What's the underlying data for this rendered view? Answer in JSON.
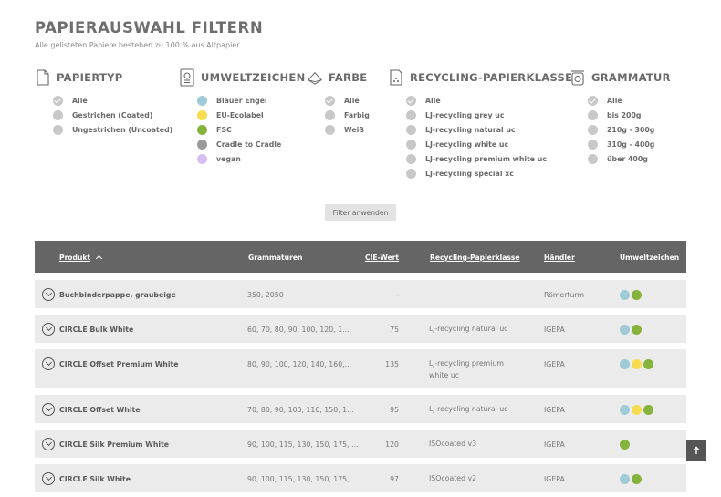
{
  "header": {
    "title": "PAPIERAUSWAHL FILTERN",
    "subtitle": "Alle gelisteten Papiere bestehen zu 100 % aus Altpapier"
  },
  "colors": {
    "blue": "#9ecbd6",
    "yellow": "#f6dc4e",
    "green": "#86b33b",
    "grey": "#9a9a9a",
    "purple": "#d7bdf0",
    "unchecked": "#c8c8c8",
    "header_bg": "#656565",
    "row_bg": "#ebebeb"
  },
  "filters": {
    "papiertyp": {
      "label": "PAPIERTYP",
      "icon": "document-icon",
      "options": [
        "Alle",
        "Gestrichen (Coated)",
        "Ungestrichen (Uncoated)"
      ]
    },
    "umweltzeichen": {
      "label": "UMWELTZEICHEN",
      "icon": "eco-label-icon",
      "options": [
        "Blauer Engel",
        "EU-Ecolabel",
        "FSC",
        "Cradle to Cradle",
        "vegan"
      ]
    },
    "farbe": {
      "label": "FARBE",
      "icon": "paper-stack-icon",
      "options": [
        "Alle",
        "Farbig",
        "Weiß"
      ]
    },
    "recycling": {
      "label": "RECYCLING-PAPIERKLASSE",
      "icon": "recycle-bin-icon",
      "options": [
        "Alle",
        "LJ-recycling grey uc",
        "LJ-recycling natural uc",
        "LJ-recycling white uc",
        "LJ-recycling premium white uc",
        "LJ-recycling special xc"
      ]
    },
    "grammatur": {
      "label": "GRAMMATUR",
      "icon": "scale-icon",
      "options": [
        "Alle",
        "bis 200g",
        "210g - 300g",
        "310g - 400g",
        "über 400g"
      ]
    }
  },
  "apply_button": "Filter anwenden",
  "table": {
    "columns": {
      "produkt": "Produkt",
      "grammaturen": "Grammaturen",
      "cie": "CIE-Wert",
      "klasse": "Recycling-Papierklasse",
      "haendler": "Händler",
      "umwelt": "Umweltzeichen"
    },
    "rows": [
      {
        "name": "Buchbinderpappe, graubeige",
        "gram": "350, 2050",
        "cie": "-",
        "klasse": "",
        "haendler": "Römerturm",
        "eco": [
          "blue",
          "green"
        ]
      },
      {
        "name": "CIRCLE Bulk White",
        "gram": "60, 70, 80, 90, 100, 120, 1...",
        "cie": "75",
        "klasse": "LJ-recycling natural uc",
        "haendler": "IGEPA",
        "eco": [
          "blue",
          "green"
        ]
      },
      {
        "name": "CIRCLE Offset Premium White",
        "gram": "80, 90, 100, 120, 140, 160,...",
        "cie": "135",
        "klasse": "LJ-recycling premium white uc",
        "haendler": "IGEPA",
        "eco": [
          "blue",
          "yellow",
          "green"
        ]
      },
      {
        "name": "CIRCLE Offset White",
        "gram": "70, 80, 90, 100, 110, 150, 1...",
        "cie": "95",
        "klasse": "LJ-recycling natural uc",
        "haendler": "IGEPA",
        "eco": [
          "blue",
          "yellow",
          "green"
        ]
      },
      {
        "name": "CIRCLE Silk Premium White",
        "gram": "90, 100, 115, 130, 150, 175, ...",
        "cie": "120",
        "klasse": "ISOcoated v3",
        "haendler": "IGEPA",
        "eco": [
          "green"
        ]
      },
      {
        "name": "CIRCLE Silk White",
        "gram": "90, 100, 115, 130, 150, 175, ...",
        "cie": "97",
        "klasse": "ISOcoated v2",
        "haendler": "IGEPA",
        "eco": [
          "blue",
          "green"
        ]
      }
    ]
  },
  "scroll_top_icon": "arrow-up-icon"
}
